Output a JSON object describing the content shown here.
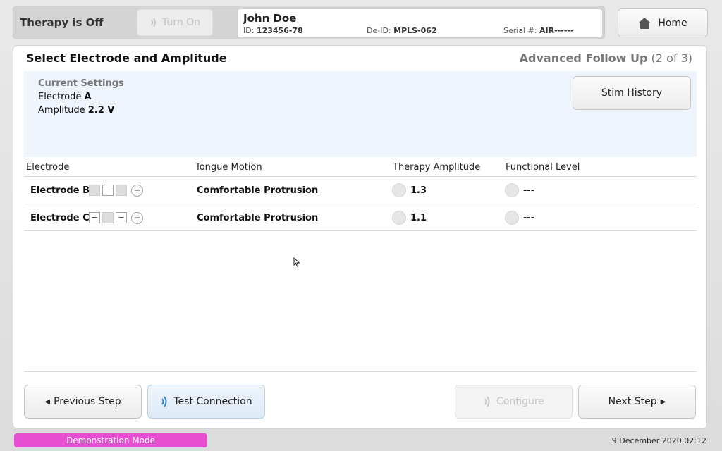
{
  "topbar": {
    "therapy_status": "Therapy is Off",
    "turn_on_label": "Turn On",
    "home_label": "Home"
  },
  "patient": {
    "name": "John Doe",
    "id_label": "ID:",
    "id_value": "123456-78",
    "deid_label": "De-ID:",
    "deid_value": "MPLS-062",
    "serial_label": "Serial #:",
    "serial_value": "AIR------"
  },
  "panel": {
    "title": "Select Electrode and Amplitude",
    "step_label": "Advanced Follow Up",
    "step_progress": "(2 of 3)"
  },
  "current_settings": {
    "title": "Current Settings",
    "electrode_label": "Electrode",
    "electrode_value": "A",
    "amplitude_label": "Amplitude",
    "amplitude_value": "2.2 V",
    "stim_history_label": "Stim History"
  },
  "table": {
    "columns": [
      "Electrode",
      "Tongue Motion",
      "Therapy Amplitude",
      "Functional Level"
    ],
    "rows": [
      {
        "electrode": "Electrode B",
        "contacts": [
          "empty",
          "minus",
          "empty",
          "plus"
        ],
        "tongue_motion": "Comfortable Protrusion",
        "amplitude": "1.3",
        "functional_level": "---"
      },
      {
        "electrode": "Electrode C",
        "contacts": [
          "minus",
          "empty",
          "minus",
          "plus"
        ],
        "tongue_motion": "Comfortable Protrusion",
        "amplitude": "1.1",
        "functional_level": "---"
      }
    ]
  },
  "footer": {
    "previous_label": "Previous Step",
    "test_label": "Test Connection",
    "configure_label": "Configure",
    "next_label": "Next Step"
  },
  "status": {
    "mode": "Demonstration Mode",
    "datetime": "9 December 2020 02:12"
  },
  "colors": {
    "demo_badge": "#e64fd2",
    "settings_bg": "#edf4fb",
    "signal_blue": "#2a7fd1"
  }
}
